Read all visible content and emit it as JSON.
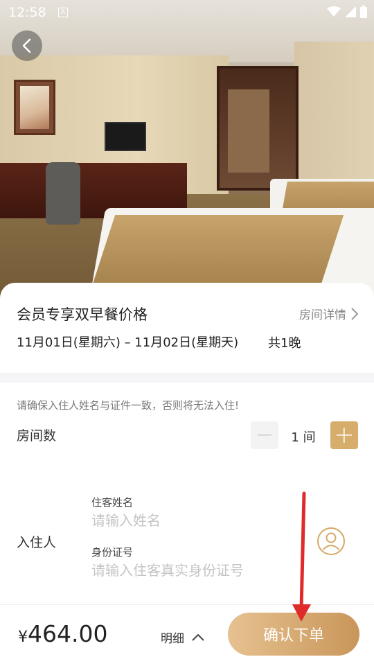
{
  "status_bar": {
    "time": "12:58",
    "a_icon": "A"
  },
  "hero": {
    "image": "hotel-room-photo"
  },
  "room": {
    "title": "会员专享双早餐价格",
    "detail_link": "房间详情",
    "dates": "11月01日(星期六) – 11月02日(星期天)",
    "nights": "共1晚"
  },
  "booking": {
    "notice": "请确保入住人姓名与证件一致，否则将无法入住!",
    "rooms_label": "房间数",
    "room_count": "1 间",
    "guest_label": "入住人",
    "name_caption": "住客姓名",
    "name_placeholder": "请输入姓名",
    "name_value": "",
    "id_caption": "身份证号",
    "id_placeholder": "请输入住客真实身份证号",
    "id_value": ""
  },
  "footer": {
    "currency": "¥",
    "price": "464.00",
    "detail_label": "明细",
    "confirm_label": "确认下单"
  },
  "colors": {
    "accent": "#d6ad6b",
    "annotation_arrow": "#e02b2b"
  }
}
